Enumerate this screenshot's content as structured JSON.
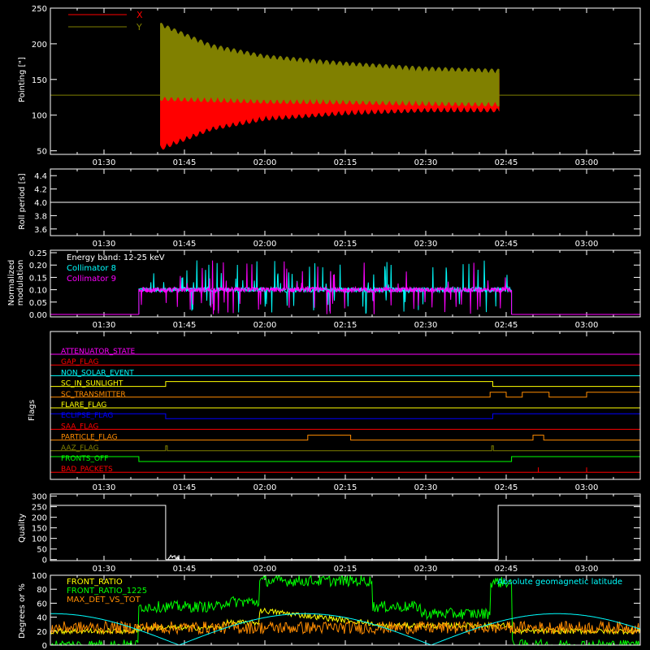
{
  "chart_data": [
    {
      "type": "line",
      "id": "pointing",
      "ylabel": "Pointing [\"]",
      "ylim": [
        45,
        250
      ],
      "yticks": [
        50,
        100,
        150,
        200,
        250
      ],
      "xlim_min": [
        80,
        190
      ],
      "xticks_min": [
        90,
        105,
        120,
        135,
        150,
        165,
        180
      ],
      "xtick_labels": [
        "01:30",
        "01:45",
        "02:00",
        "02:15",
        "02:30",
        "02:45",
        "03:00"
      ],
      "legend": [
        "X",
        "Y"
      ],
      "colors": {
        "X": "#ff0000",
        "Y": "#808000"
      },
      "baseline": 128,
      "active_start_min": 100.5,
      "active_end_min": 163.7,
      "series": [
        {
          "name": "X",
          "envelope_upper_x": [
            100.5,
            110,
            120,
            135,
            150,
            163.7
          ],
          "envelope_upper_y": [
            130,
            140,
            148,
            155,
            160,
            160
          ],
          "envelope_lower_x": [
            100.5,
            110,
            120,
            135,
            150,
            163.7
          ],
          "envelope_lower_y": [
            50,
            78,
            92,
            100,
            104,
            104
          ]
        },
        {
          "name": "Y",
          "envelope_upper_x": [
            100.5,
            110,
            120,
            135,
            150,
            163.7
          ],
          "envelope_upper_y": [
            230,
            200,
            185,
            175,
            168,
            165
          ],
          "envelope_lower_x": [
            100.5,
            110,
            120,
            135,
            150,
            163.7
          ],
          "envelope_lower_y": [
            120,
            118,
            116,
            115,
            113,
            112
          ]
        }
      ]
    },
    {
      "type": "line",
      "id": "roll",
      "ylabel": "Roll period [s]",
      "ylim": [
        3.5,
        4.5
      ],
      "yticks": [
        3.6,
        3.8,
        4.0,
        4.2,
        4.4
      ],
      "ytick_labels": [
        "3.6",
        "3.8",
        "4.0",
        "4.2",
        "4.4"
      ],
      "value": 4.0
    },
    {
      "type": "line",
      "id": "modulation",
      "ylabel_lines": [
        "Normalized",
        "modulation"
      ],
      "ylim": [
        -0.01,
        0.26
      ],
      "yticks": [
        0.0,
        0.05,
        0.1,
        0.15,
        0.2,
        0.25
      ],
      "ytick_labels": [
        "0.00",
        "0.05",
        "0.10",
        "0.15",
        "0.20",
        "0.25"
      ],
      "annotation": "Energy band: 12-25 keV",
      "legend": [
        "Collimator 8",
        "Collimator 9"
      ],
      "colors": {
        "Collimator 8": "#00ffff",
        "Collimator 9": "#ff00ff"
      },
      "active_start_min": 96.5,
      "active_end_min": 166,
      "typical_value": 0.1
    },
    {
      "type": "line",
      "id": "flags",
      "ylabel": "Flags",
      "flags": [
        {
          "name": "ATTENUATOR_STATE",
          "color": "#ff00ff",
          "changes_min": []
        },
        {
          "name": "GAP_FLAG",
          "color": "#ff0000",
          "changes_min": []
        },
        {
          "name": "NON_SOLAR_EVENT",
          "color": "#00ffff",
          "changes_min": []
        },
        {
          "name": "SC_IN_SUNLIGHT",
          "color": "#ffff00",
          "changes_min": [
            101.5,
            162.5
          ]
        },
        {
          "name": "SC_TRANSMITTER",
          "color": "#ff8c00",
          "changes_min": [
            162,
            165,
            168,
            173,
            180
          ]
        },
        {
          "name": "FLARE_FLAG",
          "color": "#ffff00",
          "changes_min": []
        },
        {
          "name": "ECLIPSE_FLAG",
          "color": "#0000ff",
          "changes_min": [
            101.5,
            162.5
          ]
        },
        {
          "name": "SAA_FLAG",
          "color": "#ff0000",
          "changes_min": []
        },
        {
          "name": "PARTICLE_FLAG",
          "color": "#ff8c00",
          "changes_min": [
            128,
            136,
            170,
            172
          ]
        },
        {
          "name": "AAZ_FLAG",
          "color": "#808000",
          "changes_min": [
            101.5,
            101.8,
            162.3,
            162.6
          ]
        },
        {
          "name": "FRONTS_OFF",
          "color": "#00ff00",
          "changes_min": [
            96.5,
            166
          ]
        },
        {
          "name": "BAD_PACKETS",
          "color": "#ff0000",
          "changes_min": []
        }
      ]
    },
    {
      "type": "line",
      "id": "quality",
      "ylabel": "Quality",
      "ylim": [
        -5,
        310
      ],
      "yticks": [
        0,
        50,
        100,
        150,
        200,
        250,
        300
      ],
      "value_high": 256,
      "x_high_end": 101.5,
      "x_high_start": 163.5
    },
    {
      "type": "line",
      "id": "ratios",
      "ylabel": "Degrees or %",
      "ylim": [
        0,
        100
      ],
      "yticks": [
        0,
        20,
        40,
        60,
        80,
        100
      ],
      "legend": [
        "FRONT_RATIO",
        "FRONT_RATIO_1225",
        "MAX_DET_VS_TOT"
      ],
      "right_label": "Absolute geomagnetic latitude",
      "colors": {
        "FRONT_RATIO": "#ffff00",
        "FRONT_RATIO_1225": "#00ff00",
        "MAX_DET_VS_TOT": "#ff8c00",
        "latitude": "#00ffff"
      }
    }
  ]
}
